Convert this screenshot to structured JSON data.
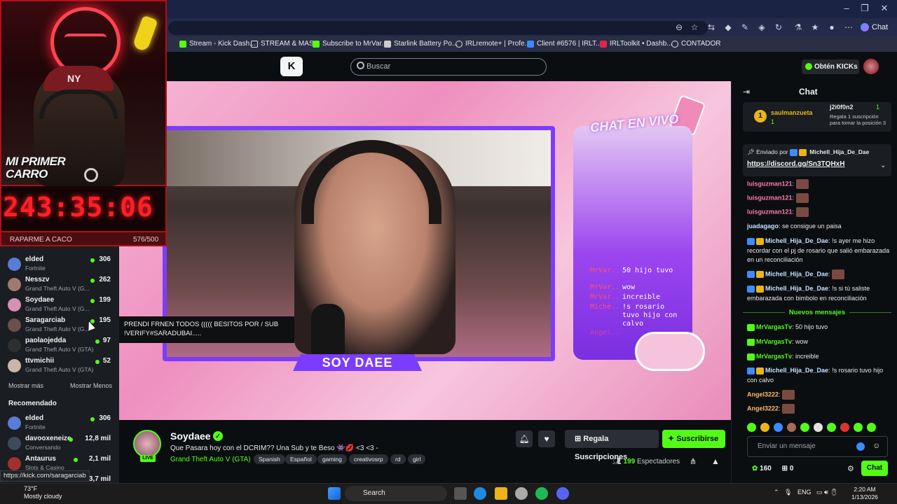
{
  "browser": {
    "bookmarks": [
      "Stream - Kick Dash...",
      "STREAM & MAS",
      "Subscribe to MrVar...",
      "Starlink Battery Po...",
      "IRLremote+ | Profe...",
      "Client #6576 | IRLT...",
      "IRLToolkit • Dashb...",
      "CONTADOR"
    ],
    "copilot_label": "Chat",
    "status_url": "https://kick.com/saragarciab"
  },
  "header": {
    "search_placeholder": "Buscar",
    "kicks_label": "Obtén KICKs"
  },
  "overlay": {
    "sign_text": "MI PRIMER CARRO",
    "cap_logo": "NY",
    "timer": "243:35:06",
    "goal_label": "RAPARME A CACO",
    "goal_count": "576/500"
  },
  "sidebar": {
    "following": [
      {
        "name": "elded",
        "game": "Fortnite",
        "viewers": "306",
        "color": "#5a7bd6"
      },
      {
        "name": "Nesszv",
        "game": "Grand Theft Auto V (G...",
        "viewers": "262",
        "color": "#a07a70"
      },
      {
        "name": "Soydaee",
        "game": "Grand Theft Auto V (G...",
        "viewers": "199",
        "color": "#d78fb3"
      },
      {
        "name": "Saragarciab",
        "game": "Grand Theft Auto V (G...",
        "viewers": "195",
        "color": "#6b4e4e"
      },
      {
        "name": "paolaojedda",
        "game": "Grand Theft Auto V (GTA)",
        "viewers": "97",
        "color": "#2f2f2f"
      },
      {
        "name": "ttvmichii",
        "game": "Grand Theft Auto V (GTA)",
        "viewers": "52",
        "color": "#c8b6a8"
      }
    ],
    "show_more": "Mostrar más",
    "show_less": "Mostrar Menos",
    "recommended_title": "Recomendado",
    "recommended": [
      {
        "name": "elded",
        "game": "Fortnite",
        "viewers": "306",
        "color": "#5a7bd6"
      },
      {
        "name": "davooxeneize",
        "game": "Conversando",
        "viewers": "12,8 mil",
        "color": "#3e4a5a"
      },
      {
        "name": "Antaurus",
        "game": "Slots & Casino",
        "viewers": "2,1 mil",
        "color": "#a23030"
      },
      {
        "name": "",
        "game": "",
        "viewers": "23,7 mil",
        "color": "#1a1d21"
      }
    ],
    "tooltip": "PRENDI FRNEN TODOS ((((( BESITOS POR / SUB !VERIFY#SARADUBAI....."
  },
  "video_overlay": {
    "chat_title": "CHAT EN VIVO",
    "lines": [
      {
        "user": "MrVar..",
        "msg": "50 hijo tuvo"
      },
      {
        "user": "MrVar..",
        "msg": "wow"
      },
      {
        "user": "MrVar..",
        "msg": "increible"
      },
      {
        "user": "Miche..",
        "msg": "!s rosario tuvo hijo con calvo"
      },
      {
        "user": "Angel..",
        "msg": ""
      }
    ],
    "label": "SOY DAEE"
  },
  "stream": {
    "name": "Soydaee",
    "live": "LIVE",
    "title": "Que Pasara hoy con el DCRIM?? Una Sub y te Beso 👾💋 <3 <3 -",
    "game": "Grand Theft Auto V (GTA)",
    "tags": [
      "Spanish",
      "Español",
      "gaming",
      "creativosrp",
      "rd",
      "girl"
    ],
    "gift_label": "Regala Suscripciones",
    "subscribe_label": "Suscribirse",
    "viewer_count": "199",
    "viewer_label": "Espectadores"
  },
  "chat": {
    "title": "Chat",
    "top_gifter_rank": "1",
    "top_gifter": "saulmanzueta",
    "top_gifter_count": "1",
    "gift_user": "j2i0f0n2",
    "gift_count": "1",
    "gift_note": "Regala 1 suscripción para tomar la posición 3",
    "pinned_by": "Enviado por",
    "pinned_user": "Michell_Hija_De_Dae",
    "pinned_link": "https://discord.gg/Sn3TQHxH",
    "messages": [
      {
        "user": "luisguzman121",
        "text": "",
        "color": "#ff7aa5",
        "emote": true
      },
      {
        "user": "luisguzman121",
        "text": "",
        "color": "#ff7aa5",
        "emote": true
      },
      {
        "user": "luisguzman121",
        "text": "",
        "color": "#ff7aa5",
        "emote": true
      },
      {
        "user": "juadagago",
        "text": "se consigue un paisa",
        "color": "#c5e1ff",
        "emote": false
      },
      {
        "user": "Michell_Hija_De_Dae",
        "text": "!s ayer me hizo recordar con el pj de rosario que salió embarazada en un reconciliación",
        "color": "#c5e1ff",
        "emote": false
      },
      {
        "user": "Michell_Hija_De_Dae",
        "text": "",
        "color": "#c5e1ff",
        "emote": true
      },
      {
        "user": "Michell_Hija_De_Dae",
        "text": "!s si tú saliste embarazada con bimbolo en reconciliación",
        "color": "#c5e1ff",
        "emote": false
      }
    ],
    "new_messages_label": "Nuevos mensajes",
    "new_messages": [
      {
        "user": "MrVargasTv",
        "text": "50 hijo tuvo",
        "color": "#53fc18"
      },
      {
        "user": "MrVargasTv",
        "text": "wow",
        "color": "#53fc18"
      },
      {
        "user": "MrVargasTv",
        "text": "increible",
        "color": "#53fc18"
      },
      {
        "user": "Michell_Hija_De_Dae",
        "text": "!s rosario tuvo hijo con calvo",
        "color": "#c5e1ff"
      },
      {
        "user": "Angel3222",
        "text": "",
        "color": "#ffb86b"
      },
      {
        "user": "Angel3222",
        "text": "",
        "color": "#ffb86b"
      }
    ],
    "input_placeholder": "Enviar un mensaje",
    "points": "160",
    "gift_count_footer": "0",
    "send_label": "Chat"
  },
  "taskbar": {
    "temp": "73°F",
    "weather": "Mostly cloudy",
    "search_label": "Search",
    "lang": "ENG",
    "time": "2:20 AM",
    "date": "1/13/2026"
  }
}
